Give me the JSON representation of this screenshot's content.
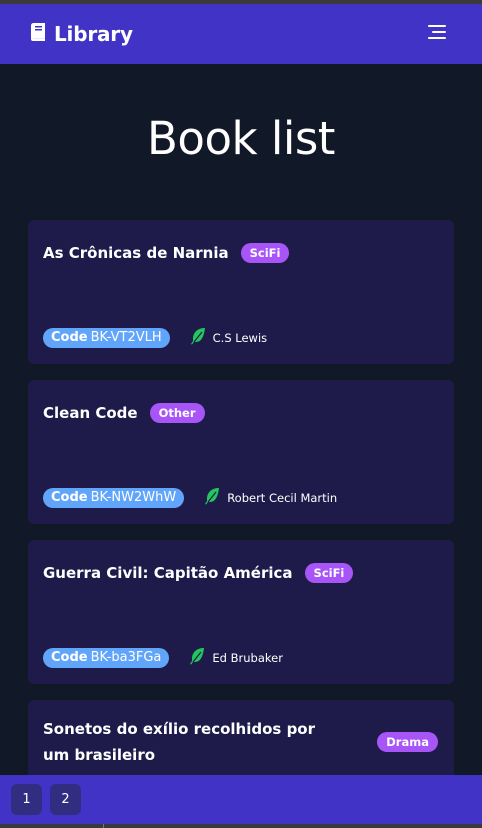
{
  "app": {
    "title": "Library"
  },
  "page": {
    "title": "Book list"
  },
  "books": [
    {
      "title": "As Crônicas de Narnia",
      "genre": "SciFi",
      "code_label": "Code",
      "code": "BK-VT2VLH",
      "author": "C.S Lewis"
    },
    {
      "title": "Clean Code",
      "genre": "Other",
      "code_label": "Code",
      "code": "BK-NW2WhW",
      "author": "Robert Cecil Martin"
    },
    {
      "title": "Guerra Civil: Capitão América",
      "genre": "SciFi",
      "code_label": "Code",
      "code": "BK-ba3FGa",
      "author": "Ed Brubaker"
    },
    {
      "title": "Sonetos do exílio recolhidos por um brasileiro",
      "genre": "Drama"
    }
  ],
  "pagination": {
    "pages": [
      "1",
      "2"
    ]
  },
  "icons": {
    "brand": "book-icon",
    "menu": "menu-icon",
    "author": "feather-icon"
  },
  "colors": {
    "navbar": "#4133c5",
    "background": "#111827",
    "card": "#1e1b4b",
    "badge": "#a855f7",
    "code_pill": "#60a5fa",
    "feather": "#22c55e"
  }
}
